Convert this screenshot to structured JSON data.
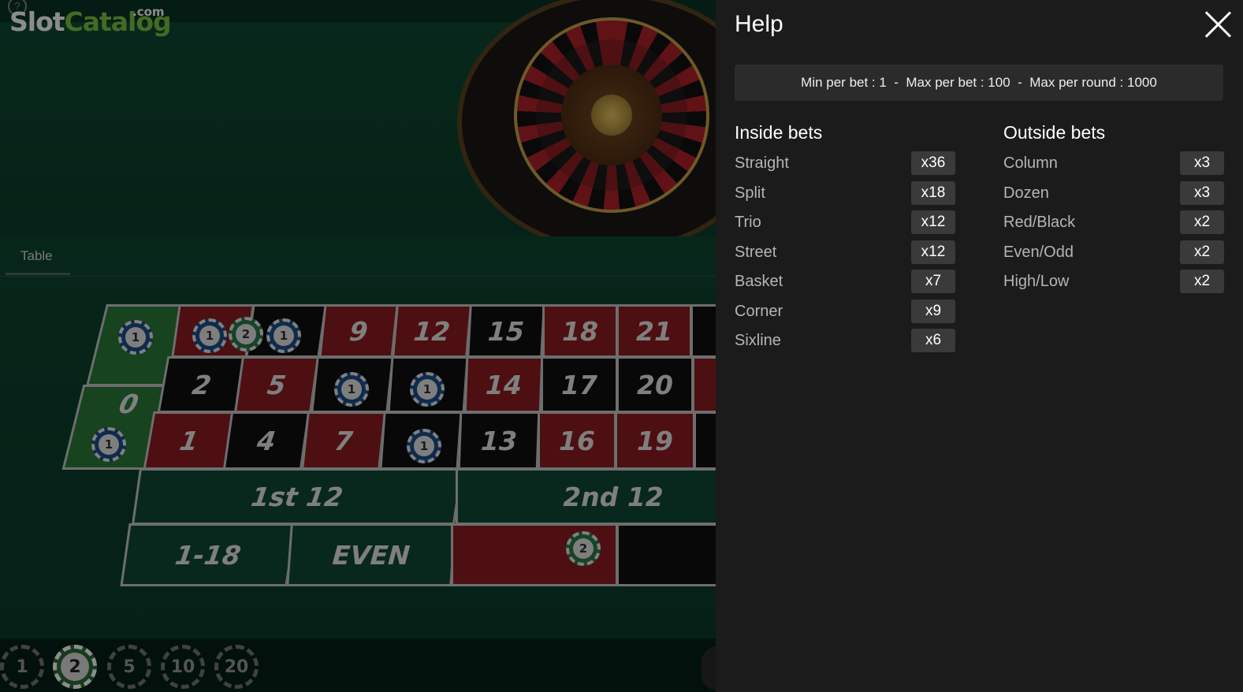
{
  "brand": {
    "logo_slot": "Slot",
    "logo_catalog": "Catalog",
    "logo_com": ".com"
  },
  "help_icon": "?",
  "table_tab": "Table",
  "layout": {
    "top_row": [
      "9",
      "12",
      "15",
      "18",
      "21"
    ],
    "middle_row": [
      "2",
      "5",
      "",
      "",
      "14",
      "17",
      "20"
    ],
    "bottom_row": [
      "1",
      "4",
      "7",
      "",
      "13",
      "16",
      "19"
    ],
    "zero": "0",
    "dozens": [
      "1st 12",
      "2nd 12"
    ],
    "outside": [
      "1-18",
      "EVEN"
    ]
  },
  "placed_chips": [
    "1",
    "1",
    "2",
    "1",
    "1",
    "1",
    "1",
    "1",
    "2"
  ],
  "chip_rack": [
    "1",
    "2",
    "5",
    "10",
    "20"
  ],
  "selected_chip": "2",
  "help": {
    "title": "Help",
    "limits": "Min per bet : 1  -  Max per bet : 100  -  Max per round : 1000",
    "inside_title": "Inside bets",
    "inside": [
      {
        "label": "Straight",
        "mult": "x36"
      },
      {
        "label": "Split",
        "mult": "x18"
      },
      {
        "label": "Trio",
        "mult": "x12"
      },
      {
        "label": "Street",
        "mult": "x12"
      },
      {
        "label": "Basket",
        "mult": "x7"
      },
      {
        "label": "Corner",
        "mult": "x9"
      },
      {
        "label": "Sixline",
        "mult": "x6"
      }
    ],
    "outside_title": "Outside bets",
    "outside": [
      {
        "label": "Column",
        "mult": "x3"
      },
      {
        "label": "Dozen",
        "mult": "x3"
      },
      {
        "label": "Red/Black",
        "mult": "x2"
      },
      {
        "label": "Even/Odd",
        "mult": "x2"
      },
      {
        "label": "High/Low",
        "mult": "x2"
      }
    ]
  }
}
